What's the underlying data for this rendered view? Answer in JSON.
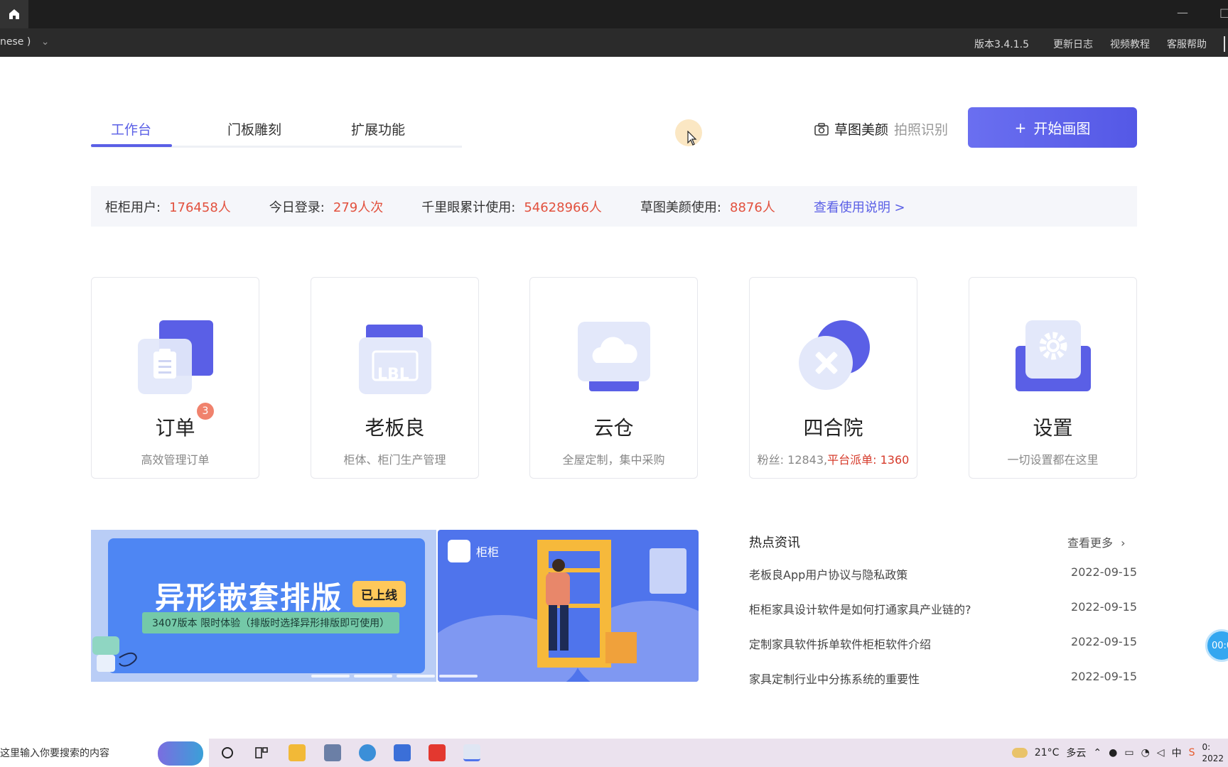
{
  "titlebar": {
    "minimize": "—",
    "restore": "□"
  },
  "menubar": {
    "language": "nese )",
    "version": "版本3.4.1.5",
    "changelog": "更新日志",
    "video_tutorial": "视频教程",
    "support": "客服帮助"
  },
  "tabs": [
    {
      "label": "工作台",
      "active": true
    },
    {
      "label": "门板雕刻",
      "active": false
    },
    {
      "label": "扩展功能",
      "active": false
    }
  ],
  "actions": {
    "sketch_beauty": "草图美颜",
    "photo_recognize": "拍照识别",
    "start_drawing": "开始画图",
    "start_plus": "+"
  },
  "stats": [
    {
      "label": "柜柜用户:",
      "value": "176458人"
    },
    {
      "label": "今日登录:",
      "value": "279人次"
    },
    {
      "label": "千里眼累计使用:",
      "value": "54628966人"
    },
    {
      "label": "草图美颜使用:",
      "value": "8876人"
    }
  ],
  "stats_link": "查看使用说明 >",
  "cards": [
    {
      "title": "订单",
      "sub": "高效管理订单",
      "badge": "3"
    },
    {
      "title": "老板良",
      "sub": "柜体、柜门生产管理",
      "icon_text": "LBL"
    },
    {
      "title": "云仓",
      "sub": "全屋定制，集中采购"
    },
    {
      "title": "四合院",
      "sub": "粉丝: 12843,",
      "sub_red": "平台派单: 1360"
    },
    {
      "title": "设置",
      "sub": "一切设置都在这里"
    }
  ],
  "banner1": {
    "title": "异形嵌套排版",
    "tag": "已上线",
    "subtitle": "3407版本 限时体验（排版时选择异形排版即可使用）"
  },
  "banner2": {
    "logo_text": "柜柜"
  },
  "news": {
    "heading": "热点资讯",
    "more": "查看更多",
    "items": [
      {
        "title": "老板良App用户协议与隐私政策",
        "date": "2022-09-15"
      },
      {
        "title": "柜柜家具设计软件是如何打通家具产业链的?",
        "date": "2022-09-15"
      },
      {
        "title": "定制家具软件拆单软件柜柜软件介绍",
        "date": "2022-09-15"
      },
      {
        "title": "家具定制行业中分拣系统的重要性",
        "date": "2022-09-15"
      }
    ]
  },
  "float_timer": "00:0",
  "taskbar": {
    "search_placeholder": "在这里输入你要搜索的内容",
    "weather_temp": "21°C",
    "weather_desc": "多云",
    "ime": "中",
    "year": "2022",
    "clock_top": "0:"
  },
  "colors": {
    "accent": "#5a5fe6",
    "stat_value": "#e2513e",
    "titlebar": "#1e1e1e"
  }
}
